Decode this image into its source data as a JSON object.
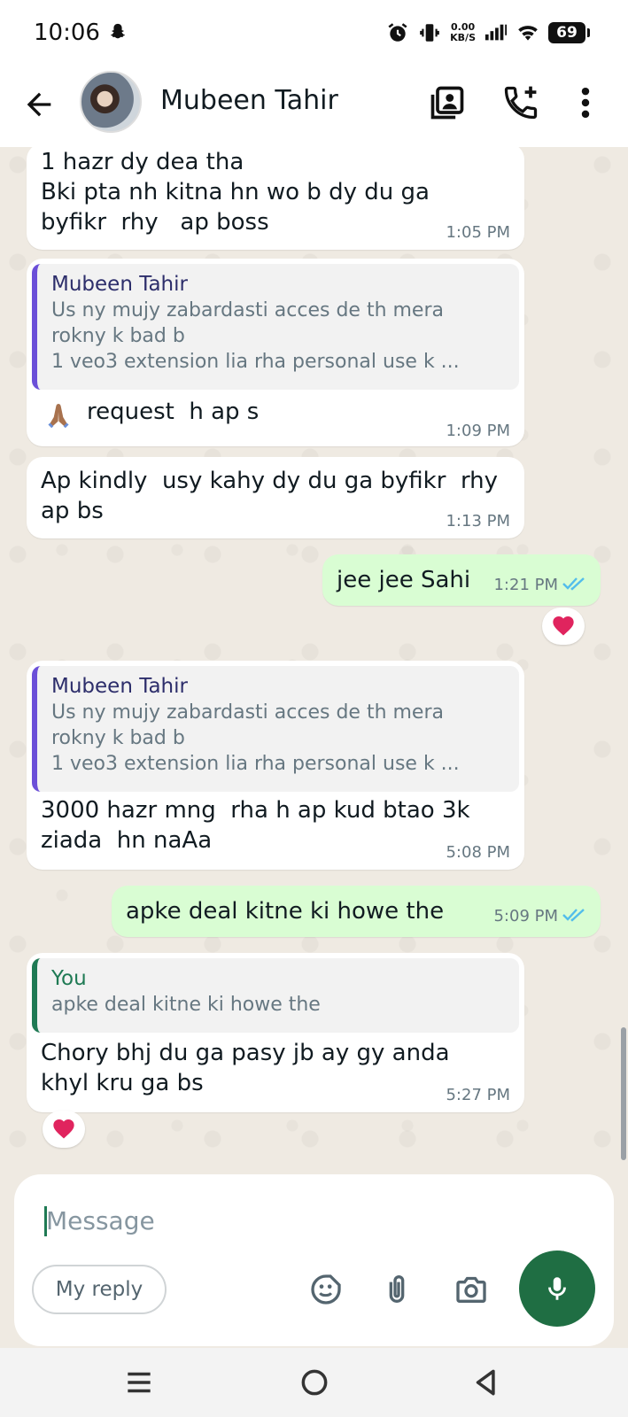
{
  "status_bar": {
    "time": "10:06",
    "net_speed_value": "0.00",
    "net_speed_unit": "KB/S",
    "battery": "69"
  },
  "header": {
    "contact_name": "Mubeen Tahir"
  },
  "messages": [
    {
      "text": "1 hazr dy dea tha\nBki pta nh kitna hn wo b dy du ga\nbyfikr  rhy   ap boss",
      "time": "1:05 PM"
    },
    {
      "quote_name": "Mubeen Tahir",
      "quote_lines": [
        "Us ny mujy zabardasti acces de th mera",
        "rokny k bad b",
        "1 veo3  extension lia rha  personal  use k ..."
      ],
      "text": "request  h ap s",
      "time": "1:09 PM"
    },
    {
      "text": "Ap kindly  usy kahy dy du ga byfikr  rhy\nap bs",
      "time": "1:13 PM"
    },
    {
      "text": "jee jee Sahi",
      "time": "1:21 PM"
    },
    {
      "quote_name": "Mubeen Tahir",
      "quote_lines": [
        "Us ny mujy zabardasti acces de th mera",
        "rokny k bad b",
        "1 veo3  extension lia rha  personal  use k ..."
      ],
      "text": "3000 hazr mng  rha h ap kud btao 3k\nziada  hn naAa",
      "time": "5:08 PM"
    },
    {
      "text": "apke deal kitne ki howe the",
      "time": "5:09 PM"
    },
    {
      "quote_name": "You",
      "quote_lines": [
        "apke deal kitne ki howe the"
      ],
      "text": "Chory bhj du ga pasy jb ay gy anda\nkhyl kru ga bs",
      "time": "5:27 PM"
    }
  ],
  "composer": {
    "placeholder": "Message",
    "my_reply": "My reply"
  },
  "icons": {
    "status": [
      "snapchat-icon",
      "alarm-icon",
      "vibrate-icon",
      "signal-icon",
      "wifi-icon",
      "battery-icon"
    ],
    "header": [
      "back-arrow-icon",
      "contact-card-icon",
      "add-call-icon",
      "more-vert-icon"
    ],
    "composer": [
      "sticker-icon",
      "attach-icon",
      "camera-icon",
      "mic-icon"
    ],
    "nav": [
      "recents-icon",
      "home-icon",
      "back-icon"
    ]
  },
  "colors": {
    "accent": "#1f6e43",
    "outgoing_bubble": "#d9fdd3",
    "incoming_bubble": "#ffffff",
    "chat_bg": "#efeae2",
    "read_ticks": "#53bdeb",
    "heart": "#e0245e"
  }
}
